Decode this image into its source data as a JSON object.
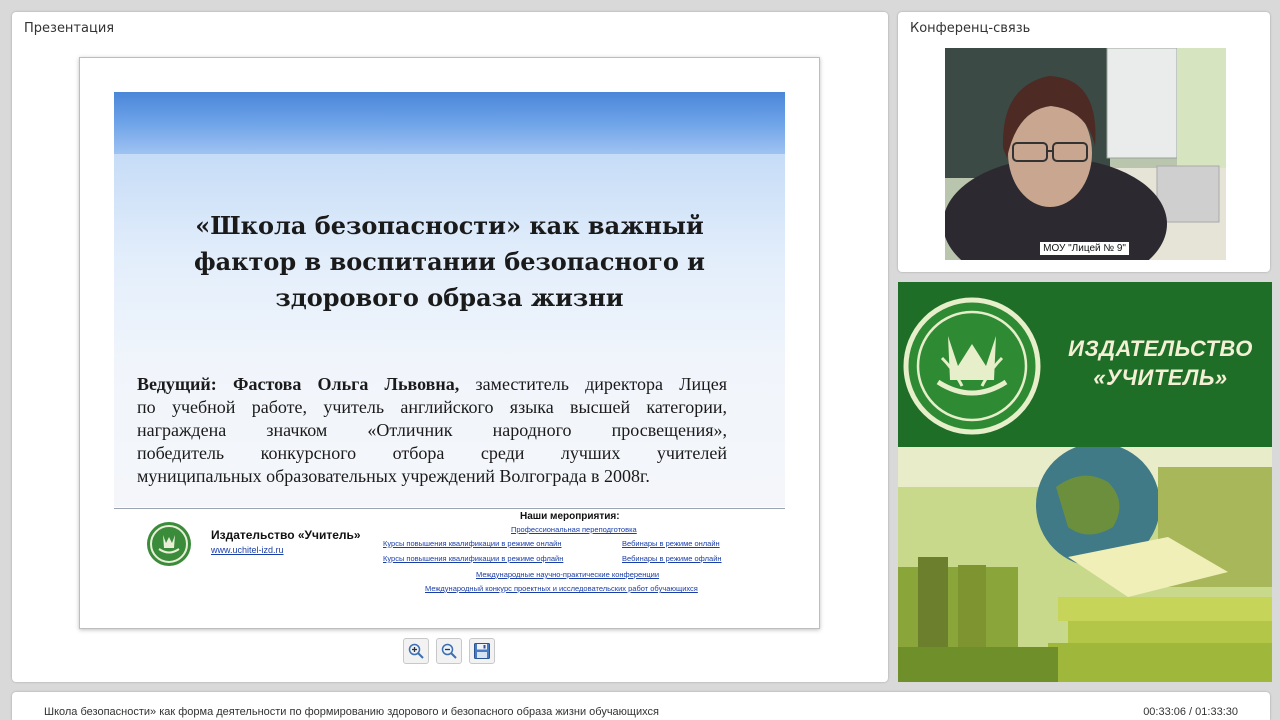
{
  "presentation_panel": {
    "title": "Презентация"
  },
  "slide": {
    "title_lines": [
      "«Школа безопасности» как важный",
      "фактор в воспитании безопасного и",
      "здорового образа жизни"
    ],
    "presenter_label": "Ведущий: Фастова Ольга Львовна,",
    "description_lines": [
      "заместитель директора Лицея",
      "по учебной работе, учитель английского языка высшей категории,",
      "награждена значком «Отличник народного просвещения»,",
      "победитель конкурсного отбора среди лучших учителей",
      "муниципальных образовательных учреждений Волгограда в 2008г."
    ],
    "publisher_name": "Издательство «Учитель»",
    "publisher_url": "www.uchitel-izd.ru",
    "events_title": "Наши мероприятия:",
    "events": {
      "retraining": "Профессиональная переподготовка",
      "courses_online": "Курсы повышения квалификации в режиме онлайн",
      "webinars_online": "Вебинары в режиме онлайн",
      "courses_offline": "Курсы повышения квалификации в режиме офлайн",
      "webinars_offline": "Вебинары в режиме офлайн",
      "conferences": "Международные научно-практические конференции",
      "contest": "Международный конкурс проектных и исследовательских работ обучающихся"
    }
  },
  "toolbar": {
    "zoom_in_icon": "zoom-in-icon",
    "zoom_out_icon": "zoom-out-icon",
    "save_icon": "save-icon"
  },
  "conference_panel": {
    "title": "Конференц-связь",
    "video_label": "МОУ \"Лицей № 9\""
  },
  "banner": {
    "line1": "ИЗДАТЕЛЬСТВО",
    "line2": "«УЧИТЕЛЬ»",
    "color": "#1f6e28"
  },
  "status_bar": {
    "title": "Школа безопасности» как форма деятельности по формированию здорового и безопасного образа жизни обучающихся",
    "time": "00:33:06 / 01:33:30"
  }
}
